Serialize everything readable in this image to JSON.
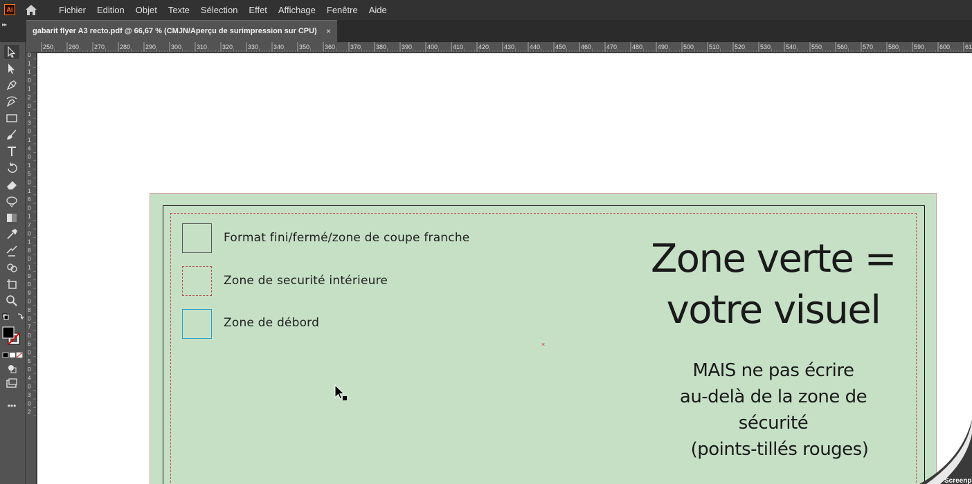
{
  "app": {
    "logo_text": "Ai"
  },
  "menu": [
    "Fichier",
    "Edition",
    "Objet",
    "Texte",
    "Sélection",
    "Effet",
    "Affichage",
    "Fenêtre",
    "Aide"
  ],
  "document_tab": {
    "title": "gabarit flyer A3 recto.pdf @ 66,67 % (CMJN/Aperçu de surimpression sur CPU)",
    "close": "×"
  },
  "toolbar": {
    "tools": [
      "selection-tool",
      "direct-selection-tool",
      "pen-tool",
      "curvature-tool",
      "rectangle-tool",
      "paintbrush-tool",
      "type-tool",
      "rotate-tool",
      "eraser-tool",
      "width-tool",
      "gradient-tool",
      "eyedropper-tool",
      "blend-tool",
      "shape-builder-tool",
      "artboard-tool",
      "zoom-tool"
    ],
    "more": "•••"
  },
  "ruler": {
    "top_labels": [
      "250",
      "260",
      "270",
      "280",
      "290",
      "300",
      "310",
      "320",
      "330",
      "340",
      "350",
      "360",
      "370",
      "380",
      "390",
      "400",
      "410",
      "420",
      "430",
      "440",
      "450",
      "460",
      "470",
      "480",
      "490",
      "500",
      "510",
      "520",
      "530",
      "540",
      "550",
      "560",
      "570",
      "580",
      "590",
      "600",
      "61"
    ],
    "left_digits": [
      "0",
      "1",
      "1",
      "0",
      "1",
      "2",
      "0",
      "1",
      "3",
      "0",
      "1",
      "4",
      "0",
      "1",
      "5",
      "0",
      "1",
      "6",
      "0",
      "1",
      "7",
      "0",
      "1",
      "8",
      "0",
      "1",
      "9",
      "0",
      "9",
      "0",
      "8",
      "0",
      "7",
      "0",
      "6",
      "0",
      "5",
      "0",
      "4",
      "0",
      "3",
      "0",
      "2"
    ]
  },
  "artboard": {
    "legend": [
      {
        "label": "Format fini/fermé/zone de coupe franche"
      },
      {
        "label": "Zone de securité intérieure"
      },
      {
        "label": "Zone de débord"
      }
    ],
    "headline_line1": "Zone verte =",
    "headline_line2": "votre visuel",
    "note_line1": "MAIS ne pas écrire",
    "note_line2": "au-delà de la zone de",
    "note_line3": "sécurité",
    "note_line4": "(points-tillés rouges)",
    "center_mark": "×"
  },
  "colors": {
    "green_zone": "#c6e0c6",
    "safety_dashed": "#c84b4b",
    "bleed_cyan": "#2aa0c8",
    "app_orange": "#ff7c00"
  },
  "page_curl_text": "Screenp"
}
